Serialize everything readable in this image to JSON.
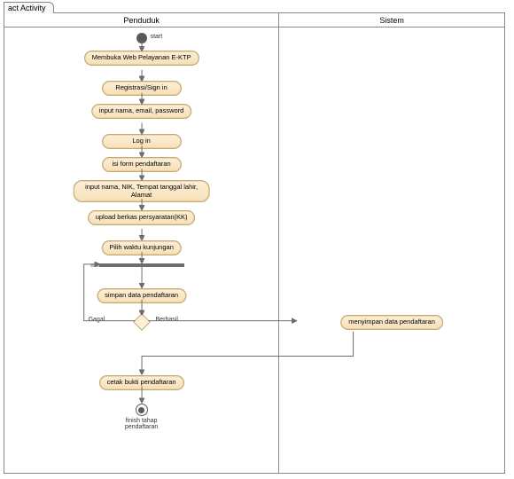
{
  "frame": {
    "tab": "act Activity"
  },
  "lanes": {
    "left": "Penduduk",
    "right": "Sistem"
  },
  "labels": {
    "start": "start",
    "finish": "finish tahap\npendaftaran",
    "gagal": "Gagal",
    "berhasil": "Berhasil"
  },
  "nodes": {
    "n1": "Membuka Web\nPelayanan E-KTP",
    "n2": "Registrasi/Sign in",
    "n3": "input nama, email,\npassword",
    "n4": "Log in",
    "n5": "isi form pendaftaran",
    "n6": "input nama, NIK, Tempat\ntanggal lahir, Alamat",
    "n7": "upload berkas\npersyaratan(KK)",
    "n8": "Pilih waktu kunjungan",
    "n9": "simpan data pendaftaran",
    "n10": "cetak bukti pendaftaran",
    "s1": "menyimpan data\npendaftaran"
  }
}
